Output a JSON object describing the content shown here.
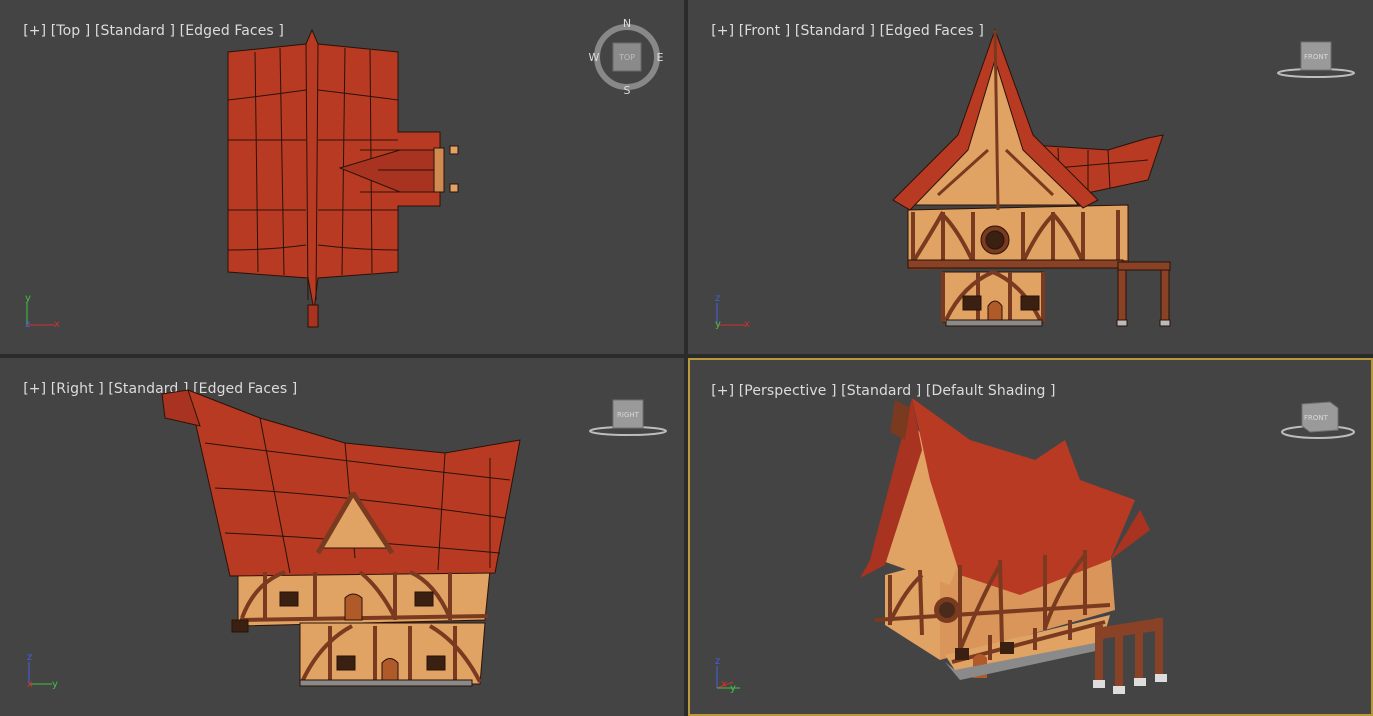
{
  "viewports": {
    "top": {
      "label_parts": [
        "[+]",
        "[Top ]",
        "[Standard ]",
        "[Edged Faces ]"
      ],
      "viewcube": {
        "face": "TOP",
        "compass": {
          "n": "N",
          "s": "S",
          "e": "E",
          "w": "W"
        }
      },
      "axes": {
        "a": "y",
        "b": "z",
        "c": "x"
      }
    },
    "front": {
      "label_parts": [
        "[+]",
        "[Front ]",
        "[Standard ]",
        "[Edged Faces ]"
      ],
      "viewcube": {
        "face": "FRONT"
      },
      "axes": {
        "a": "z",
        "b": "y",
        "c": "x"
      }
    },
    "right": {
      "label_parts": [
        "[+]",
        "[Right ]",
        "[Standard ]",
        "[Edged Faces ]"
      ],
      "viewcube": {
        "face": "RIGHT"
      },
      "axes": {
        "a": "z",
        "b": "x",
        "c": "y"
      }
    },
    "perspective": {
      "label_parts": [
        "[+]",
        "[Perspective ]",
        "[Standard ]",
        "[Default Shading ]"
      ],
      "viewcube": {
        "face": "FRONT"
      },
      "axes": {
        "a": "z",
        "b": "x",
        "c": "y"
      },
      "active": true
    }
  },
  "colors": {
    "viewport_bg": "#444444",
    "active_border": "#b89a3c",
    "roof": "#b83a23",
    "wall": "#e0a364",
    "timber": "#7a3a20"
  }
}
